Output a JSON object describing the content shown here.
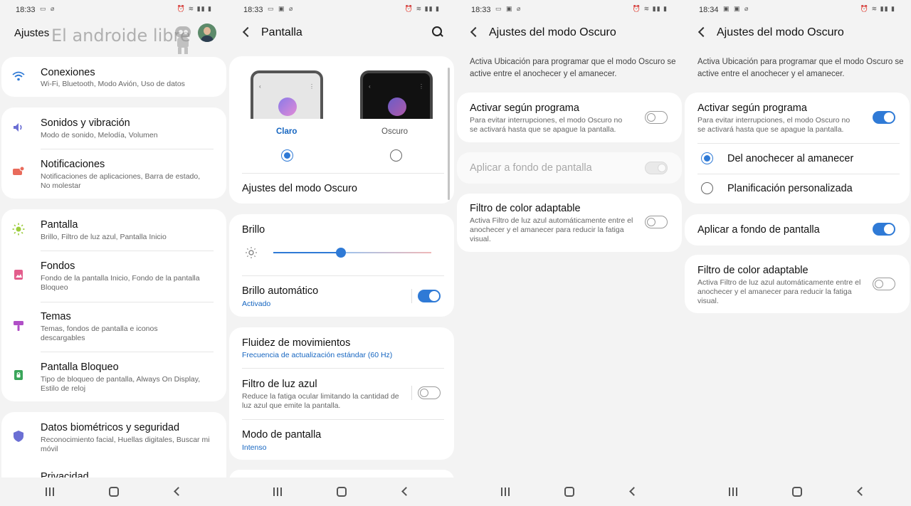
{
  "status": [
    {
      "time": "18:33"
    },
    {
      "time": "18:33"
    },
    {
      "time": "18:33"
    },
    {
      "time": "18:34"
    }
  ],
  "colors": {
    "accent": "#2f7ad6",
    "link_blue": "#1565c0",
    "background": "#f3f3f3",
    "card": "#ffffff"
  },
  "screen1": {
    "title": "Ajustes",
    "watermark": "El androide libre",
    "items": [
      {
        "icon": "wifi-icon",
        "title": "Conexiones",
        "subtitle": "Wi-Fi, Bluetooth, Modo Avión, Uso de datos"
      },
      {
        "icon": "sound-icon",
        "title": "Sonidos y vibración",
        "subtitle": "Modo de sonido, Melodía, Volumen"
      },
      {
        "icon": "notification-icon",
        "title": "Notificaciones",
        "subtitle": "Notificaciones de aplicaciones, Barra de estado, No molestar"
      },
      {
        "icon": "brightness-icon",
        "title": "Pantalla",
        "subtitle": "Brillo, Filtro de luz azul, Pantalla Inicio"
      },
      {
        "icon": "wallpaper-icon",
        "title": "Fondos",
        "subtitle": "Fondo de la pantalla Inicio, Fondo de la pantalla Bloqueo"
      },
      {
        "icon": "theme-brush-icon",
        "title": "Temas",
        "subtitle": "Temas, fondos de pantalla e iconos descargables"
      },
      {
        "icon": "lock-icon",
        "title": "Pantalla Bloqueo",
        "subtitle": "Tipo de bloqueo de pantalla, Always On Display, Estilo de reloj"
      },
      {
        "icon": "shield-icon",
        "title": "Datos biométricos y seguridad",
        "subtitle": "Reconocimiento facial, Huellas digitales, Buscar mi móvil"
      },
      {
        "icon": "privacy-icon",
        "title": "Privacidad",
        "subtitle": ""
      }
    ]
  },
  "screen2": {
    "title": "Pantalla",
    "mode_light": "Claro",
    "mode_dark": "Oscuro",
    "dark_settings": "Ajustes del modo Oscuro",
    "brightness": "Brillo",
    "brightness_level": 0.43,
    "auto_brightness": "Brillo automático",
    "auto_brightness_state": "Activado",
    "motion_smoothness": "Fluidez de movimientos",
    "motion_smoothness_value": "Frecuencia de actualización estándar (60 Hz)",
    "blue_light": "Filtro de luz azul",
    "blue_light_desc": "Reduce la fatiga ocular limitando la cantidad de luz azul que emite la pantalla.",
    "screen_mode": "Modo de pantalla",
    "screen_mode_value": "Intenso"
  },
  "screen3": {
    "title": "Ajustes del modo Oscuro",
    "desc": "Activa Ubicación para programar que el modo Oscuro se active entre el anochecer y el amanecer.",
    "schedule": "Activar según programa",
    "schedule_desc": "Para evitar interrupciones, el modo Oscuro no se activará hasta que se apague la pantalla.",
    "wallpaper": "Aplicar a fondo de pantalla",
    "adaptive": "Filtro de color adaptable",
    "adaptive_desc": "Activa Filtro de luz azul automáticamente entre el anochecer y el amanecer para reducir la fatiga visual."
  },
  "screen4": {
    "title": "Ajustes del modo Oscuro",
    "desc": "Activa Ubicación para programar que el modo Oscuro se active entre el anochecer y el amanecer.",
    "schedule": "Activar según programa",
    "schedule_desc": "Para evitar interrupciones, el modo Oscuro no se activará hasta que se apague la pantalla.",
    "option_sunset": "Del anochecer al amanecer",
    "option_custom": "Planificación personalizada",
    "wallpaper": "Aplicar a fondo de pantalla",
    "adaptive": "Filtro de color adaptable",
    "adaptive_desc": "Activa Filtro de luz azul automáticamente entre el anochecer y el amanecer para reducir la fatiga visual."
  }
}
